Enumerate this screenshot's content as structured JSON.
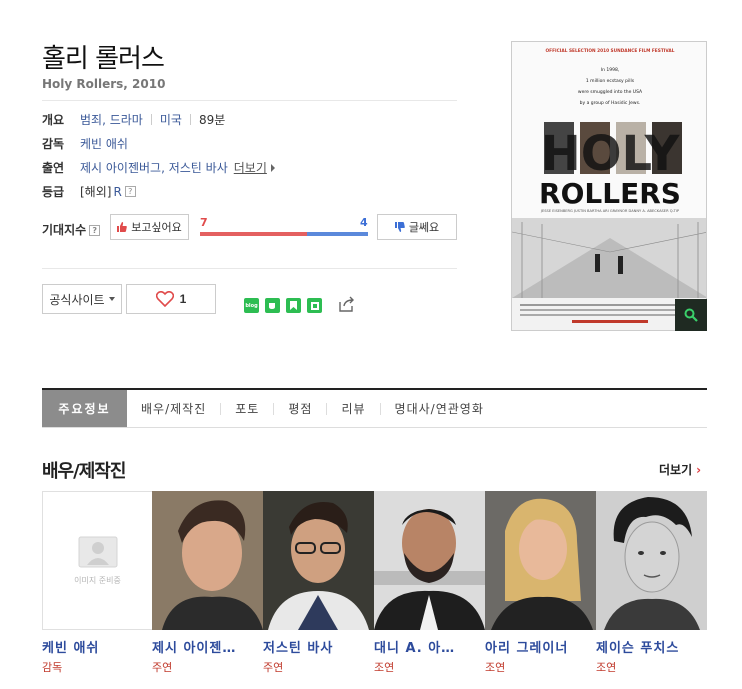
{
  "movie": {
    "title_ko": "홀리 롤러스",
    "title_en": "Holy Rollers, 2010"
  },
  "info": {
    "overview_label": "개요",
    "genre": "범죄, 드라마",
    "country": "미국",
    "runtime": "89분",
    "director_label": "감독",
    "director": "케빈 애쉬",
    "cast_label": "출연",
    "cast_list": "제시 아이젠버그, 저스틴 바사",
    "cast_more": "더보기",
    "rating_label": "등급",
    "rating_region": "[해외]",
    "rating_value": "R",
    "help_mark": "?"
  },
  "expect": {
    "label": "기대지수",
    "want_label": "보고싶어요",
    "want_count": "7",
    "meh_label": "글쎄요",
    "meh_count": "4",
    "want_ratio": 0.636
  },
  "actions": {
    "site_label": "공식사이트",
    "like_count": "1"
  },
  "poster": {
    "festival": "OFFICIAL SELECTION 2010 SUNDANCE FILM FESTIVAL",
    "tagline": [
      "In 1998,",
      "1 million ecstasy pills",
      "were smuggled into the USA",
      "by a group of Hasidic Jews."
    ],
    "title_line1": "HOLY",
    "title_line2": "ROLLERS",
    "actors_line": "JESSE EISENBERG  JUSTIN BARTHA  ARI GRAYNOR  DANNY A. ABECKASER  Q-TIP"
  },
  "tabs": [
    "주요정보",
    "배우/제작진",
    "포토",
    "평점",
    "리뷰",
    "명대사/연관영화"
  ],
  "cast_section": {
    "title": "배우/제작진",
    "more": "더보기",
    "placeholder_text": "이미지 준비중",
    "people": [
      {
        "name": "케빈 애쉬",
        "role": "감독"
      },
      {
        "name": "제시 아이젠…",
        "role": "주연"
      },
      {
        "name": "저스틴 바사",
        "role": "주연"
      },
      {
        "name": "대니 A. 아…",
        "role": "조연"
      },
      {
        "name": "아리 그레이너",
        "role": "조연"
      },
      {
        "name": "제이슨 푸치스",
        "role": "조연"
      }
    ]
  },
  "colors": {
    "link_blue": "#2d4b9c",
    "red": "#e04b4b",
    "blue": "#3c6fd6",
    "tab_active": "#8c8c8c"
  }
}
